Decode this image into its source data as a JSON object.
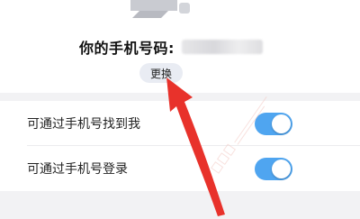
{
  "profile": {
    "phone_label": "你的手机号码:",
    "change_button_label": "更换"
  },
  "settings": {
    "items": [
      {
        "label": "可通过手机号找到我",
        "enabled": true
      },
      {
        "label": "可通过手机号登录",
        "enabled": true
      }
    ]
  },
  "colors": {
    "toggle_on": "#4fa5f0",
    "arrow": "#e8322b",
    "button_bg": "#e9ecf3",
    "section_bg": "#f2f2f4"
  }
}
